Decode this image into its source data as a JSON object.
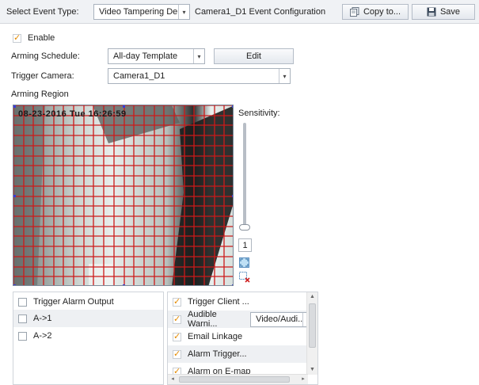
{
  "toolbar": {
    "event_type_label": "Select Event Type:",
    "event_type_value": "Video Tampering De...",
    "config_title": "Camera1_D1 Event Configuration",
    "copy_label": "Copy to...",
    "save_label": "Save"
  },
  "enable": {
    "label": "Enable",
    "checked": true
  },
  "arming_schedule": {
    "label": "Arming Schedule:",
    "value": "All-day Template",
    "edit_label": "Edit"
  },
  "trigger_camera": {
    "label": "Trigger Camera:",
    "value": "Camera1_D1"
  },
  "arming_region": {
    "label": "Arming Region",
    "osd_text": "08-23-2016 Tue 16:26:59",
    "grid_color": "#cc1a1a"
  },
  "sensitivity": {
    "label": "Sensitivity:",
    "value": "1",
    "level": 0.0
  },
  "alarm_output": {
    "header": "Trigger Alarm Output",
    "items": [
      "A->1",
      "A->2"
    ]
  },
  "linkage": {
    "items": [
      {
        "label": "Trigger Client ...",
        "checked": true
      },
      {
        "label": "Audible Warni...",
        "checked": true,
        "select": "Video/Audi..."
      },
      {
        "label": "Email Linkage",
        "checked": true
      },
      {
        "label": "Alarm Trigger...",
        "checked": true
      },
      {
        "label": "Alarm on E-map",
        "checked": true
      }
    ]
  },
  "colors": {
    "toolbar_bg": "#f0f2f5",
    "check_accent": "#e48a00",
    "region_grid": "#cc1a1a"
  }
}
